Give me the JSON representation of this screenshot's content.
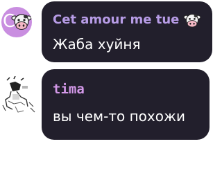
{
  "messages": [
    {
      "author": "Cet amour me tue",
      "author_badge_icon": "cow-icon",
      "avatar_letter": "C",
      "avatar_icon": "cow-icon",
      "text": "Жаба хуйня"
    },
    {
      "author": "tima",
      "avatar_icon": "sketch-avatar-icon",
      "text": "вы чем-то похожи"
    }
  ],
  "colors": {
    "bubble": "#221f2c",
    "author_1": "#b79ce6",
    "author_2": "#d398e8",
    "message_text": "#ffffff",
    "avatar_bg": "#c98ee0"
  }
}
